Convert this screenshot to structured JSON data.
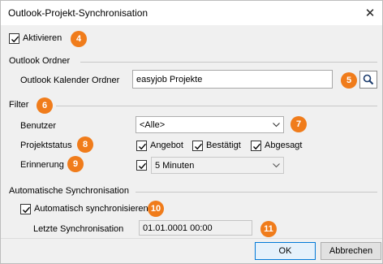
{
  "dialog": {
    "title": "Outlook-Projekt-Synchronisation",
    "close_glyph": "✕"
  },
  "activate": {
    "label": "Aktivieren",
    "checked": true
  },
  "outlook_folder": {
    "section_label": "Outlook Ordner",
    "calendar_label": "Outlook Kalender Ordner",
    "calendar_value": "easyjob Projekte"
  },
  "filter": {
    "section_label": "Filter",
    "user_label": "Benutzer",
    "user_value": "<Alle>",
    "project_status_label": "Projektstatus",
    "statuses": [
      {
        "label": "Angebot",
        "checked": true
      },
      {
        "label": "Bestätigt",
        "checked": true
      },
      {
        "label": "Abgesagt",
        "checked": true
      }
    ],
    "reminder_label": "Erinnerung",
    "reminder_checked": true,
    "reminder_value": "5 Minuten"
  },
  "auto_sync": {
    "section_label": "Automatische Synchronisation",
    "auto_label": "Automatisch synchronisieren",
    "auto_checked": true,
    "last_sync_label": "Letzte Synchronisation",
    "last_sync_value": "01.01.0001 00:00"
  },
  "badges": [
    "4",
    "5",
    "6",
    "7",
    "8",
    "9",
    "10",
    "11"
  ],
  "buttons": {
    "ok": "OK",
    "cancel": "Abbrechen"
  },
  "colors": {
    "badge": "#f07c1b",
    "default_button_border": "#0078d7"
  }
}
